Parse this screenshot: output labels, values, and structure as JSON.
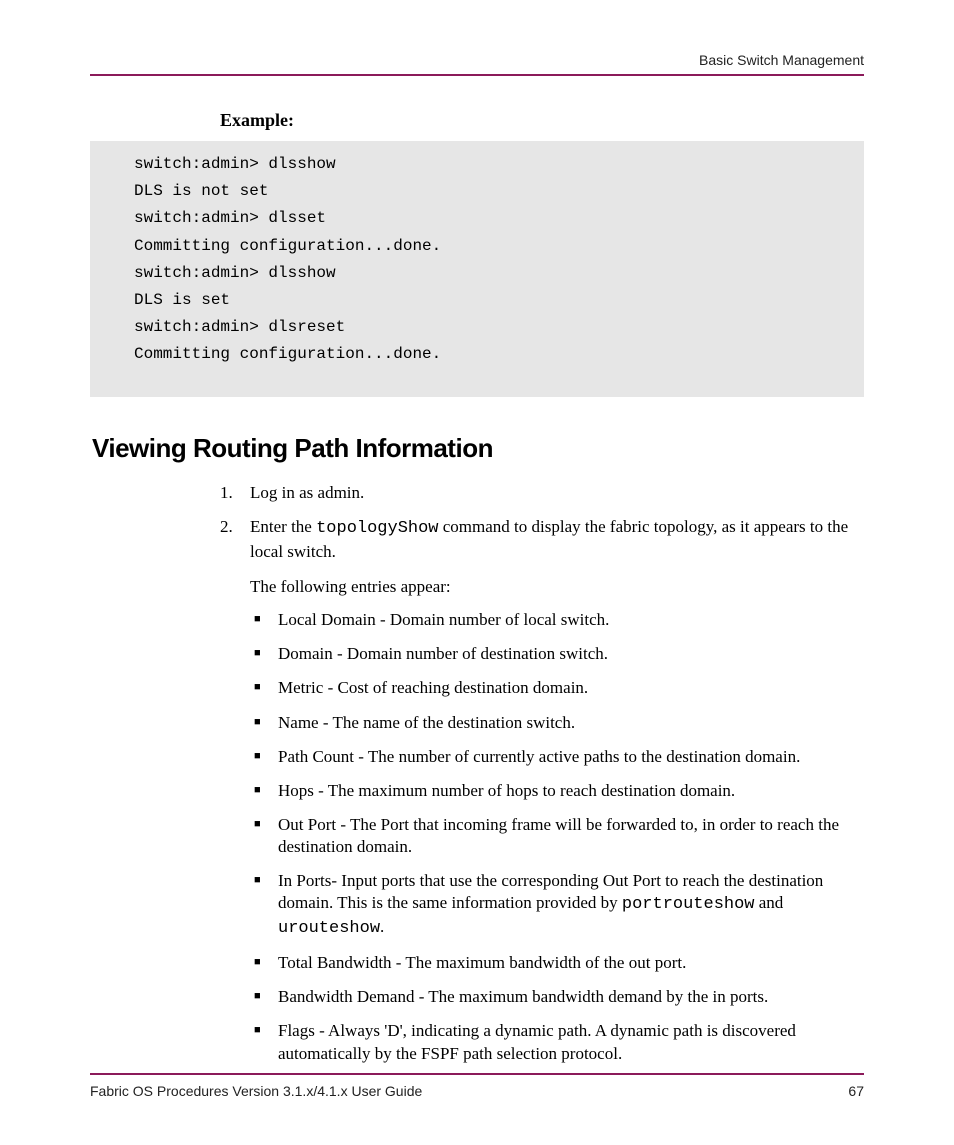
{
  "header": {
    "right": "Basic Switch Management"
  },
  "example_label": "Example:",
  "code_lines": [
    "switch:admin> dlsshow",
    "DLS is not set",
    "switch:admin> dlsset",
    "Committing configuration...done.",
    "switch:admin> dlsshow",
    "DLS is set",
    "switch:admin> dlsreset",
    "Committing configuration...done."
  ],
  "section_heading": "Viewing Routing Path Information",
  "steps": {
    "s1": {
      "num": "1.",
      "text": "Log in as admin."
    },
    "s2": {
      "num": "2.",
      "pre": "Enter the ",
      "cmd": "topologyShow",
      "post": " command to display the fabric topology, as it appears to the local switch.",
      "followup": "The following entries appear:"
    }
  },
  "bullets": {
    "b0": "Local Domain - Domain number of local switch.",
    "b1": "Domain - Domain number of destination switch.",
    "b2": "Metric - Cost of reaching destination domain.",
    "b3": "Name - The name of the destination switch.",
    "b4": "Path Count - The number of currently active paths to the destination domain.",
    "b5": "Hops - The maximum number of hops to reach destination domain.",
    "b6": "Out Port - The Port that incoming frame will be forwarded to, in order to reach the destination domain.",
    "b7": {
      "pre": "In Ports- Input ports that use the corresponding Out Port to reach the destination domain. This is the same information provided by ",
      "cmd1": "portrouteshow",
      "mid": " and ",
      "cmd2": "urouteshow",
      "post": "."
    },
    "b8": "Total Bandwidth - The maximum bandwidth of the out port.",
    "b9": "Bandwidth Demand - The maximum bandwidth demand by the in ports.",
    "b10": "Flags - Always 'D', indicating a dynamic path. A dynamic path is discovered automatically by the FSPF path selection protocol."
  },
  "footer": {
    "left": "Fabric OS Procedures Version 3.1.x/4.1.x User Guide",
    "right": "67"
  }
}
